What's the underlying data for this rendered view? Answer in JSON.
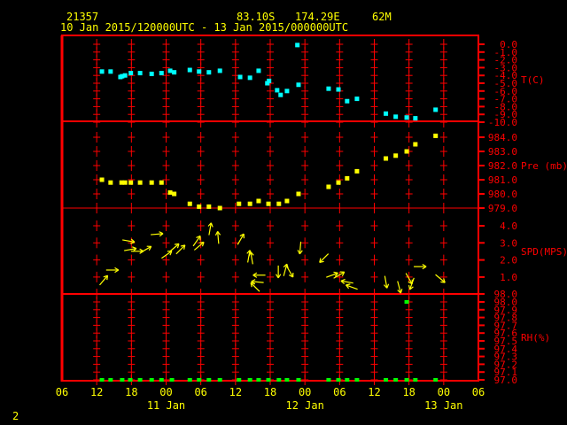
{
  "header": {
    "station": "21357",
    "latitude": "83.10S",
    "longitude": "174.29E",
    "elevation": "62M",
    "period": "10 Jan 2015/120000UTC - 13 Jan 2015/000000UTC"
  },
  "page_number": "2",
  "colors": {
    "frame": "#ff0000",
    "text": "#ffff00",
    "temperature": "#00ffff",
    "pressure": "#ffff00",
    "wind": "#ffff00",
    "rh": "#00ff00"
  },
  "chart_data": {
    "type": "scatter",
    "x_unit": "hours since 10 Jan 2015 06 UTC",
    "xlim": [
      0,
      72
    ],
    "x_tick_labels": [
      "06",
      "12",
      "18",
      "00",
      "06",
      "12",
      "18",
      "00",
      "06",
      "12",
      "18",
      "00",
      "06"
    ],
    "day_labels": [
      {
        "label": "11 Jan",
        "hour": 18
      },
      {
        "label": "12 Jan",
        "hour": 42
      },
      {
        "label": "13 Jan",
        "hour": 66
      }
    ],
    "panels": [
      {
        "name": "temperature",
        "ylabel": "T(C)",
        "ylim": [
          -10,
          0
        ],
        "tick_labels": [
          "0.0",
          "-1.0",
          "-2.0",
          "-3.0",
          "-4.0",
          "-5.0",
          "-6.0",
          "-7.0",
          "-8.0",
          "-9.0",
          "-10.0"
        ],
        "x": [
          6.9,
          8.4,
          10.1,
          10.4,
          10.9,
          11.9,
          13.5,
          15.5,
          17.2,
          18.7,
          19.4,
          22.1,
          23.7,
          25.4,
          27.3,
          30.8,
          32.5,
          34.0,
          35.5,
          35.8,
          37.2,
          37.8,
          38.9,
          40.7,
          40.9,
          46.1,
          47.8,
          49.3,
          51.0,
          56.0,
          57.7,
          59.6,
          61.1,
          64.6
        ],
        "y": [
          -3.5,
          -3.5,
          -4.2,
          -4.1,
          -4.0,
          -3.7,
          -3.7,
          -3.8,
          -3.7,
          -3.4,
          -3.6,
          -3.3,
          -3.5,
          -3.6,
          -3.4,
          -4.2,
          -4.3,
          -3.4,
          -5.0,
          -4.7,
          -5.9,
          -6.5,
          -6.0,
          -0.1,
          -5.2,
          -5.7,
          -5.8,
          -7.3,
          -7.0,
          -8.9,
          -9.3,
          -9.4,
          -9.5,
          -8.4
        ]
      },
      {
        "name": "pressure",
        "ylabel": "Pre (mb)",
        "ylim": [
          979,
          984
        ],
        "tick_labels": [
          "984.0",
          "983.0",
          "982.0",
          "981.0",
          "980.0",
          "979.0"
        ],
        "x": [
          6.9,
          8.4,
          10.3,
          10.9,
          11.9,
          13.5,
          15.5,
          17.2,
          18.7,
          19.4,
          22.1,
          23.7,
          25.4,
          27.3,
          30.6,
          32.5,
          34.0,
          35.7,
          37.5,
          38.9,
          40.9,
          46.1,
          47.8,
          49.3,
          51.0,
          56.0,
          57.7,
          59.6,
          61.1,
          64.6
        ],
        "y": [
          981.0,
          980.8,
          980.8,
          980.8,
          980.8,
          980.8,
          980.8,
          980.8,
          980.1,
          980.0,
          979.3,
          979.1,
          979.1,
          979.0,
          979.3,
          979.3,
          979.5,
          979.3,
          979.3,
          979.5,
          980.0,
          980.5,
          980.8,
          981.1,
          981.6,
          982.5,
          982.7,
          983.0,
          983.5,
          984.1
        ]
      },
      {
        "name": "wind",
        "ylabel": "SPD(MPS)",
        "ylim": [
          0,
          5
        ],
        "tick_labels": [
          "4.0",
          "3.0",
          "2.0",
          "1.0"
        ],
        "x": [
          7.2,
          8.7,
          11.5,
          11.8,
          13.0,
          14.5,
          16.4,
          18.1,
          19.4,
          20.5,
          23.3,
          23.7,
          25.6,
          27.0,
          30.9,
          32.3,
          32.8,
          34.1,
          33.8,
          33.4,
          37.4,
          38.6,
          39.4,
          41.2,
          45.3,
          46.7,
          47.9,
          49.3,
          50.1,
          56.0,
          58.3,
          60.0,
          60.5,
          61.9,
          65.4
        ],
        "speed": [
          0.8,
          1.4,
          3.1,
          2.6,
          2.5,
          2.6,
          3.5,
          2.3,
          2.7,
          2.6,
          3.1,
          2.8,
          3.8,
          3.3,
          3.2,
          2.2,
          2.1,
          1.1,
          0.7,
          0.4,
          1.3,
          1.4,
          1.3,
          2.7,
          2.1,
          1.1,
          1.1,
          0.7,
          0.4,
          0.7,
          0.4,
          0.9,
          0.6,
          1.6,
          0.9
        ],
        "arrow_angle_deg": [
          50,
          0,
          -10,
          10,
          0,
          30,
          5,
          35,
          40,
          45,
          55,
          40,
          80,
          95,
          60,
          80,
          100,
          180,
          175,
          135,
          270,
          75,
          300,
          265,
          225,
          20,
          30,
          170,
          160,
          280,
          285,
          300,
          250,
          0,
          320
        ]
      },
      {
        "name": "rh",
        "ylabel": "RH(%)",
        "ylim": [
          97.0,
          98.1
        ],
        "tick_labels": [
          "98.0",
          "98.0",
          "97.9",
          "97.8",
          "97.7",
          "97.6",
          "97.5",
          "97.4",
          "97.3",
          "97.2",
          "97.1",
          "97.0"
        ],
        "x": [
          6.9,
          8.4,
          10.4,
          11.8,
          13.5,
          15.5,
          17.2,
          19.0,
          22.1,
          23.7,
          25.4,
          27.3,
          30.6,
          32.5,
          34.0,
          35.7,
          37.5,
          38.9,
          40.9,
          46.1,
          47.8,
          49.3,
          51.0,
          56.0,
          57.7,
          59.6,
          61.1,
          64.6,
          59.6
        ],
        "y": [
          97.0,
          97.0,
          97.0,
          97.0,
          97.0,
          97.0,
          97.0,
          97.0,
          97.0,
          97.0,
          97.0,
          97.0,
          97.0,
          97.0,
          97.0,
          97.0,
          97.0,
          97.0,
          97.0,
          97.0,
          97.0,
          97.0,
          97.0,
          97.0,
          97.0,
          97.0,
          97.0,
          97.0,
          98.0
        ]
      }
    ]
  }
}
